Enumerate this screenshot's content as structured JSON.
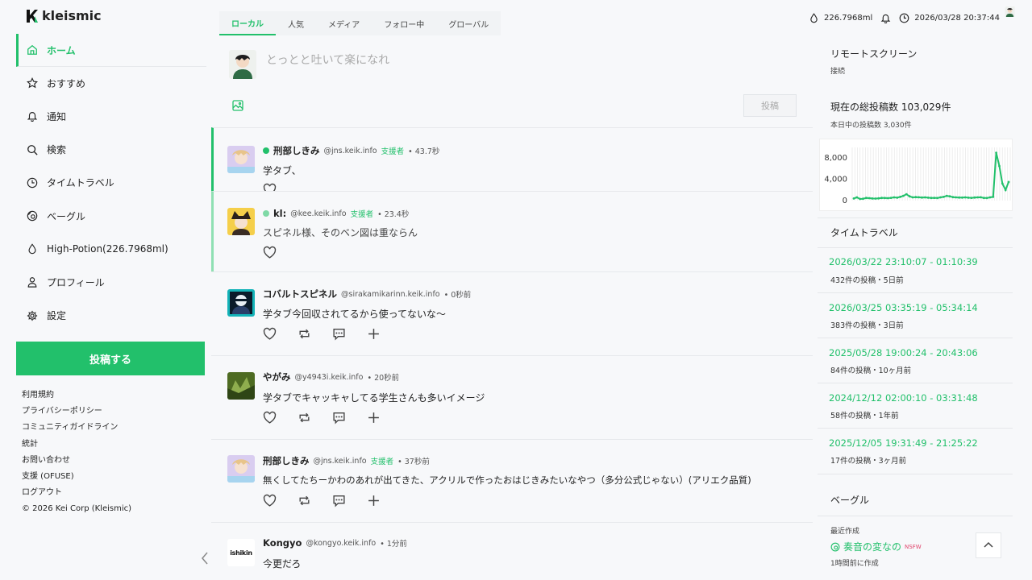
{
  "app": {
    "logo_text": "kleismic"
  },
  "sidebar": {
    "items": [
      {
        "label": "ホーム",
        "icon": "home-icon"
      },
      {
        "label": "おすすめ",
        "icon": "star-icon"
      },
      {
        "label": "通知",
        "icon": "bell-icon"
      },
      {
        "label": "検索",
        "icon": "search-icon"
      },
      {
        "label": "タイムトラベル",
        "icon": "clock-icon"
      },
      {
        "label": "ベーグル",
        "icon": "bagel-icon"
      },
      {
        "label": "High-Potion(226.7968ml)",
        "icon": "drop-icon"
      },
      {
        "label": "プロフィール",
        "icon": "user-icon"
      },
      {
        "label": "設定",
        "icon": "gear-icon"
      }
    ],
    "post_button": "投稿する",
    "footer": [
      "利用規約",
      "プライバシーポリシー",
      "コミュニティガイドライン",
      "統計",
      "お問い合わせ",
      "支援 (OFUSE)",
      "ログアウト",
      "© 2026 Kei Corp (Kleismic)"
    ]
  },
  "tabs": [
    "ローカル",
    "人気",
    "メディア",
    "フォロー中",
    "グローバル"
  ],
  "composer": {
    "placeholder": "とっとと吐いて楽になれ",
    "submit": "投稿"
  },
  "posts": [
    {
      "name": "刑部しきみ",
      "handle": "@jns.keik.info",
      "supporter": "支援者",
      "time": "• 43.7秒",
      "body": "学タブ、",
      "color": "#c9b8e8"
    },
    {
      "name": "kl:",
      "handle": "@kee.keik.info",
      "supporter": "支援者",
      "time": "• 23.4秒",
      "body": "スピネル様、そのベン図は重ならん",
      "color": "#3a2c24"
    },
    {
      "name": "コバルトスピネル",
      "handle": "@sirakamikarinn.keik.info",
      "supporter": "",
      "time": "• 0秒前",
      "body": "学タブ今回収されてるから使ってないな〜",
      "color": "#14b3b8"
    },
    {
      "name": "やがみ",
      "handle": "@y4943i.keik.info",
      "supporter": "",
      "time": "• 20秒前",
      "body": "学タブでキャッキャしてる学生さんも多いイメージ",
      "color": "#6d8a3a"
    },
    {
      "name": "刑部しきみ",
      "handle": "@jns.keik.info",
      "supporter": "支援者",
      "time": "• 37秒前",
      "body": "無くしてたちーかわのあれが出てきた、アクリルで作ったおはじきみたいなやつ（多分公式じゃない）(アリエク品質)",
      "color": "#c9b8e8"
    },
    {
      "name": "Kongyo",
      "handle": "@kongyo.keik.info",
      "supporter": "",
      "time": "• 1分前",
      "body": "今更だろ",
      "color": "#ffffff",
      "avatar_text": "ishikin"
    }
  ],
  "topbar": {
    "potion": "226.7968ml",
    "datetime": "2026/03/28 20:37:44"
  },
  "right": {
    "remote_title": "リモートスクリーン",
    "remote_sub": "接続",
    "total_title": "現在の総投稿数 103,029件",
    "today": "本日中の投稿数 3,030件",
    "timetravel_title": "タイムトラベル",
    "timetravel": [
      {
        "range": "2026/03/22 23:10:07 - 01:10:39",
        "meta": "432件の投稿・5日前"
      },
      {
        "range": "2026/03/25 03:35:19 - 05:34:14",
        "meta": "383件の投稿・3日前"
      },
      {
        "range": "2025/05/28 19:00:24 - 20:43:06",
        "meta": "84件の投稿・10ヶ月前"
      },
      {
        "range": "2024/12/12 02:00:10 - 03:31:48",
        "meta": "58件の投稿・1年前"
      },
      {
        "range": "2025/12/05 19:31:49 - 21:25:22",
        "meta": "17件の投稿・3ヶ月前"
      }
    ],
    "bagel_title": "ベーグル",
    "bagel_recent": "最近作成",
    "bagel_name": "奏音の変なの",
    "bagel_tag": "NSFW",
    "bagel_time": "1時間前に作成"
  },
  "chart_data": {
    "type": "line",
    "ylim": [
      0,
      10000
    ],
    "yticks": [
      "8,000",
      "4,000",
      "0"
    ],
    "values": [
      400,
      600,
      300,
      350,
      500,
      450,
      400,
      380,
      420,
      500,
      480,
      450,
      520,
      600,
      550,
      700,
      900,
      1200,
      800,
      600,
      650,
      620,
      580,
      600,
      550,
      500,
      520,
      480,
      600,
      700,
      900,
      800,
      650,
      600,
      580,
      560,
      600,
      550,
      520,
      580,
      600,
      620,
      500,
      480,
      600,
      700,
      9000,
      6500,
      3200,
      2000,
      3500
    ]
  }
}
